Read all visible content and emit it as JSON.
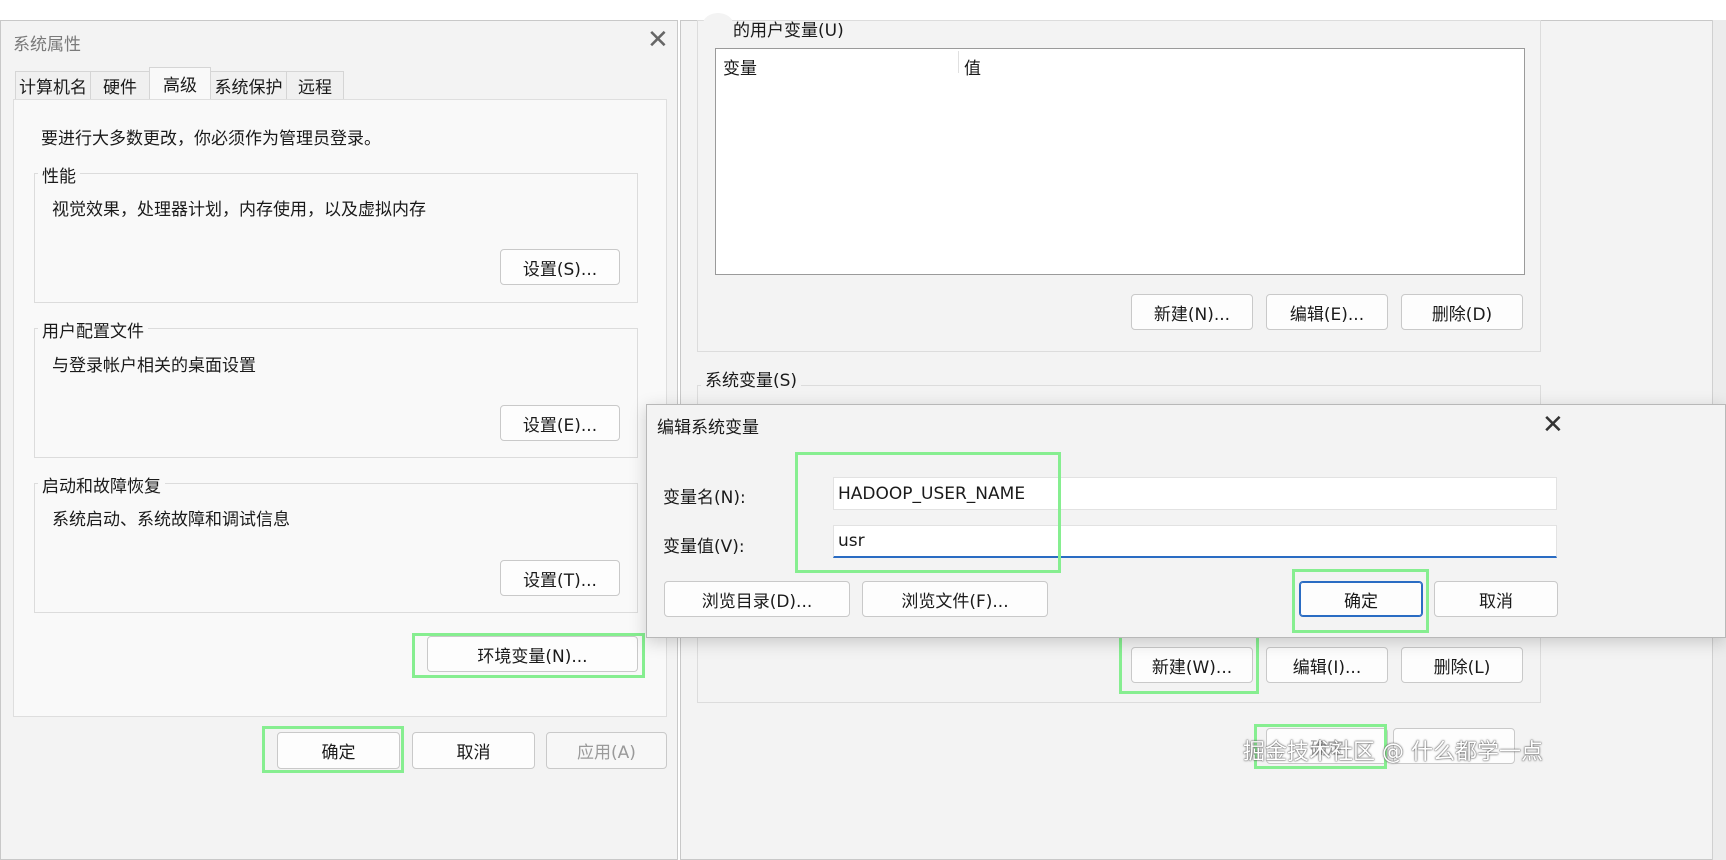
{
  "sys_props": {
    "title": "系统属性",
    "tabs": [
      "计算机名",
      "硬件",
      "高级",
      "系统保护",
      "远程"
    ],
    "admin_note": "要进行大多数更改，你必须作为管理员登录。",
    "performance": {
      "title": "性能",
      "desc": "视觉效果，处理器计划，内存使用，以及虚拟内存",
      "button": "设置(S)..."
    },
    "user_profile": {
      "title": "用户配置文件",
      "desc": "与登录帐户相关的桌面设置",
      "button": "设置(E)..."
    },
    "startup": {
      "title": "启动和故障恢复",
      "desc": "系统启动、系统故障和调试信息",
      "button": "设置(T)..."
    },
    "env_button": "环境变量(N)...",
    "ok": "确定",
    "cancel": "取消",
    "apply": "应用(A)"
  },
  "env_vars": {
    "user_section": "的用户变量(U)",
    "col_var": "变量",
    "col_val": "值",
    "user_new": "新建(N)...",
    "user_edit": "编辑(E)...",
    "user_delete": "删除(D)",
    "sys_section": "系统变量(S)",
    "sys_new": "新建(W)...",
    "sys_edit": "编辑(I)...",
    "sys_delete": "删除(L)",
    "ok_partial": "确定"
  },
  "edit_dialog": {
    "title": "编辑系统变量",
    "name_label": "变量名(N):",
    "name_value": "HADOOP_USER_NAME",
    "value_label": "变量值(V):",
    "value_value": "usr",
    "browse_dir": "浏览目录(D)...",
    "browse_file": "浏览文件(F)...",
    "ok": "确定",
    "cancel": "取消"
  },
  "watermark": "掘金技术社区 @ 什么都学一点",
  "colors": {
    "highlight": "#86ee90",
    "focus": "#2a6cc3"
  }
}
